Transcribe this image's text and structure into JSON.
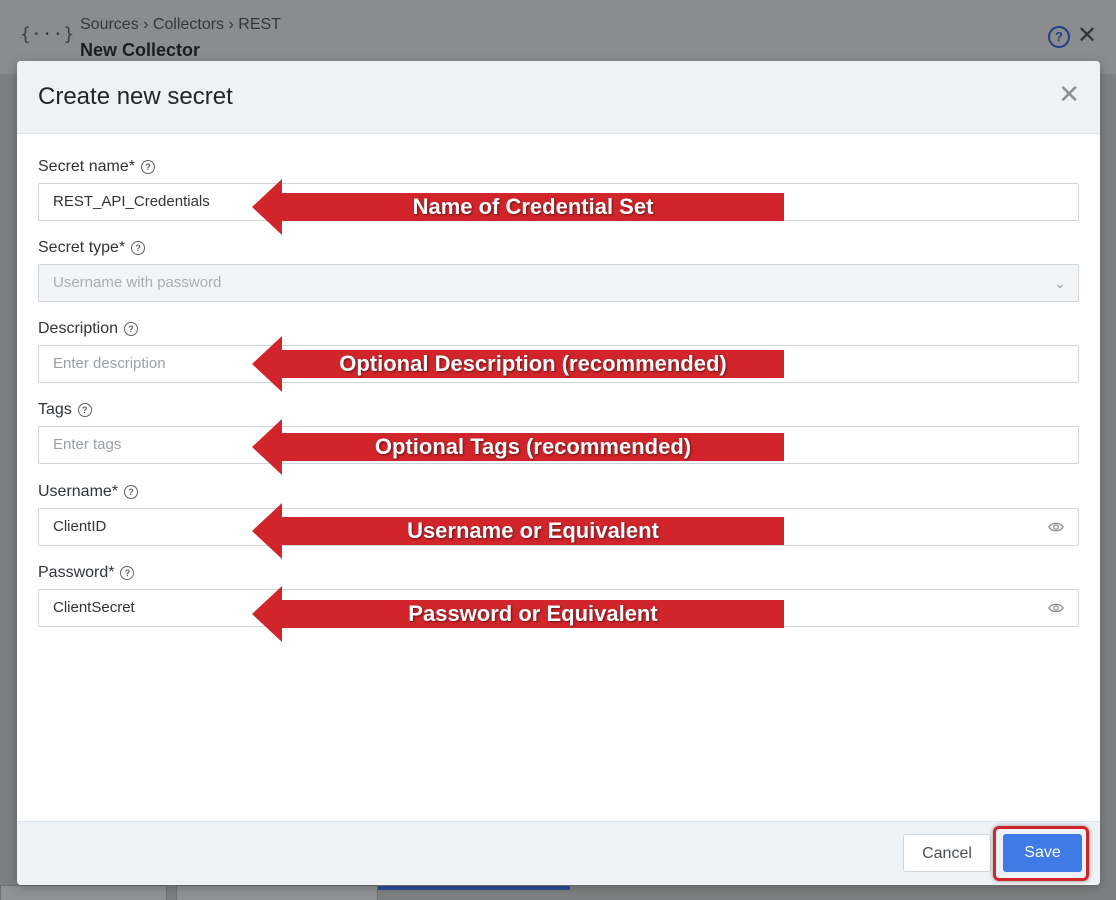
{
  "background": {
    "breadcrumb": "Sources › Collectors › REST",
    "page_title": "New Collector",
    "logo_glyph": "{···}",
    "help_glyph": "?",
    "close_glyph": "✕"
  },
  "modal": {
    "title": "Create new secret",
    "close_glyph": "✕"
  },
  "form": {
    "secret_name": {
      "label": "Secret name*",
      "value": "REST_API_Credentials"
    },
    "secret_type": {
      "label": "Secret type*",
      "value": "Username with password"
    },
    "description": {
      "label": "Description",
      "placeholder": "Enter description"
    },
    "tags": {
      "label": "Tags",
      "placeholder": "Enter tags"
    },
    "username": {
      "label": "Username*",
      "value": "ClientID"
    },
    "password": {
      "label": "Password*",
      "value": "ClientSecret"
    }
  },
  "footer": {
    "cancel_label": "Cancel",
    "save_label": "Save"
  },
  "annotations": [
    "Name of Credential Set",
    "Optional Description (recommended)",
    "Optional Tags (recommended)",
    "Username or Equivalent",
    "Password or Equivalent"
  ],
  "colors": {
    "accent": "#3f7be6",
    "annotation_red": "#d1252b"
  },
  "icons": {
    "help": "help-circle-icon",
    "dropdown": "chevron-down-icon",
    "reveal": "eye-icon",
    "close": "close-icon"
  }
}
